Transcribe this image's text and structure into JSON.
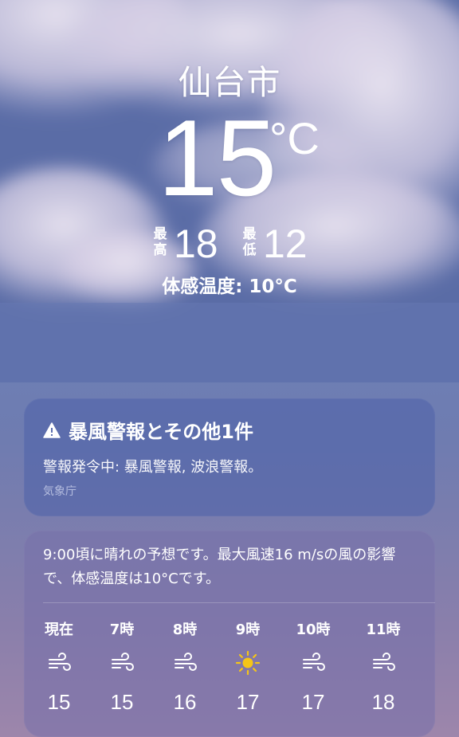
{
  "location": {
    "city": "仙台市"
  },
  "current": {
    "temperature": "15",
    "unit": "°C",
    "high_label": "最高",
    "high": "18",
    "low_label": "最低",
    "low": "12",
    "feels_like": "体感温度: 10°C"
  },
  "alert": {
    "icon": "warning-icon",
    "title": "暴風警報とその他1件",
    "body": "警報発令中: 暴風警報, 波浪警報。",
    "source": "気象庁"
  },
  "forecast": {
    "summary": "9:00頃に晴れの予想です。最大風速16 m/sの風の影響で、体感温度は10°Cです。",
    "hours": [
      {
        "label": "現在",
        "icon": "wind-icon",
        "temp": "15"
      },
      {
        "label": "7時",
        "icon": "wind-icon",
        "temp": "15"
      },
      {
        "label": "8時",
        "icon": "wind-icon",
        "temp": "16"
      },
      {
        "label": "9時",
        "icon": "sun-icon",
        "temp": "17"
      },
      {
        "label": "10時",
        "icon": "wind-icon",
        "temp": "17"
      },
      {
        "label": "11時",
        "icon": "wind-icon",
        "temp": "18"
      }
    ]
  },
  "colors": {
    "sun": "#f5c518",
    "text": "#ffffff"
  }
}
